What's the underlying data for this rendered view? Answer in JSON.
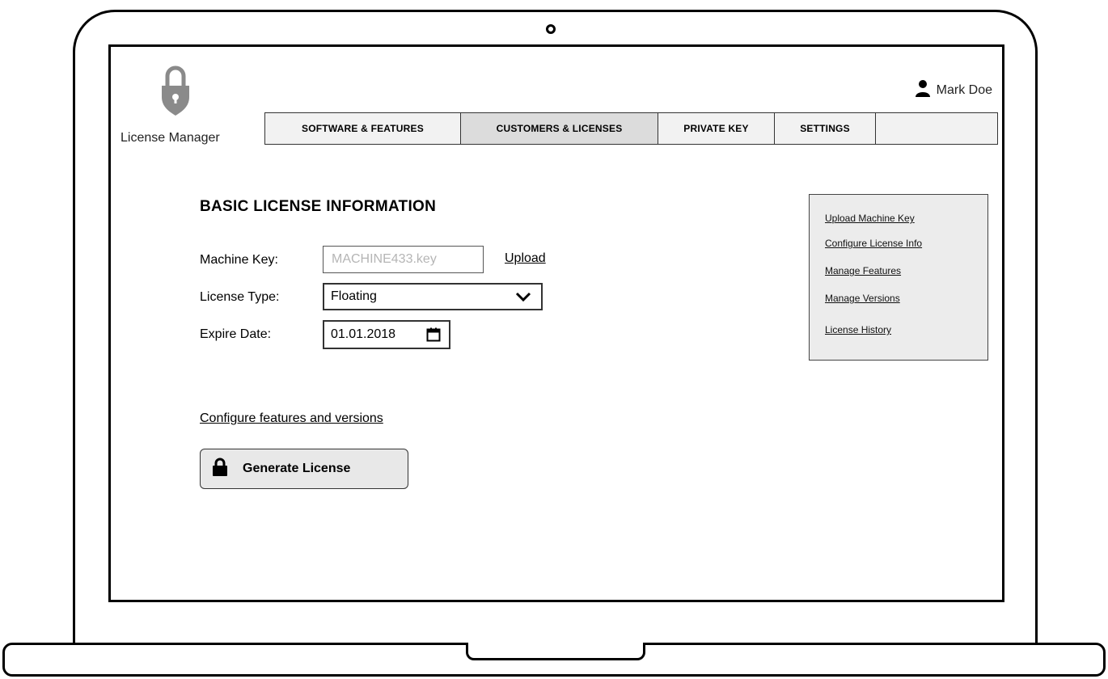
{
  "app": {
    "title": "License Manager",
    "user_name": "Mark Doe"
  },
  "nav": {
    "tabs": [
      {
        "label": "SOFTWARE & FEATURES",
        "active": false
      },
      {
        "label": "CUSTOMERS & LICENSES",
        "active": true
      },
      {
        "label": "PRIVATE KEY",
        "active": false
      },
      {
        "label": "SETTINGS",
        "active": false
      },
      {
        "label": "",
        "active": false
      }
    ]
  },
  "form": {
    "section_title": "BASIC LICENSE INFORMATION",
    "machine_key_label": "Machine Key:",
    "machine_key_placeholder": "MACHINE433.key",
    "upload_link": "Upload",
    "license_type_label": "License Type:",
    "license_type_value": "Floating",
    "expire_date_label": "Expire Date:",
    "expire_date_value": "01.01.2018",
    "configure_link": "Configure features and versions",
    "generate_button": "Generate License"
  },
  "side_panel": {
    "links": [
      "Upload Machine Key",
      "Configure License Info",
      "Manage Features",
      "Manage Versions",
      "License History"
    ]
  },
  "icons": {
    "logo": "shield-lock-icon",
    "user": "user-icon",
    "dropdown": "chevron-down-icon",
    "calendar": "calendar-icon",
    "button": "lock-icon"
  },
  "colors": {
    "logo_gray": "#8a8a8a",
    "active_tab": "#dcdcdc",
    "panel_bg": "#ececec"
  }
}
